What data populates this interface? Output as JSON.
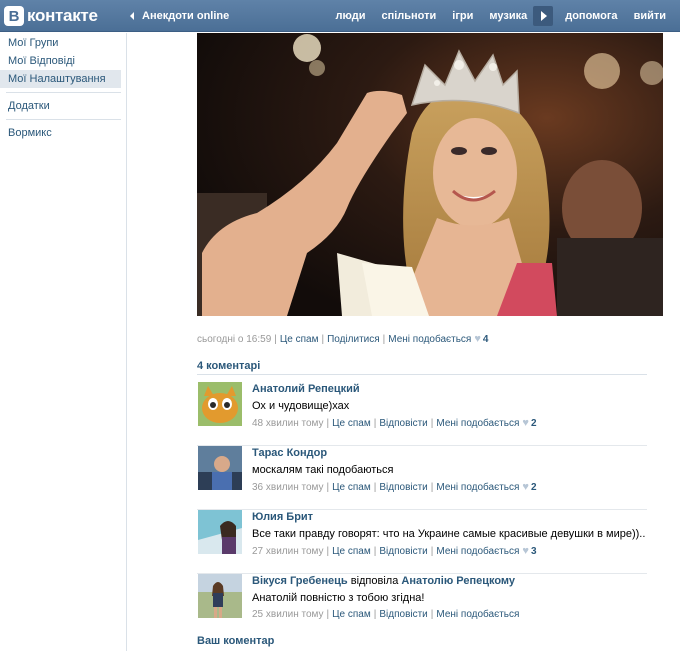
{
  "header": {
    "logo_letter": "В",
    "logo_text": "контакте",
    "back_label": "Анекдоти online",
    "nav": [
      "люди",
      "спільноти",
      "ігри",
      "музика",
      "допомога",
      "вийти"
    ]
  },
  "sidebar": {
    "items": [
      "Мої Групи",
      "Мої Відповіді",
      "Мої Налаштування",
      "Додатки",
      "Вормикс"
    ]
  },
  "post": {
    "time": "сьогодні о 16:59",
    "spam": "Це спам",
    "share": "Поділитися",
    "like": "Мені подобається",
    "like_count": "4",
    "comments_title": "4 коментарі"
  },
  "comments": [
    {
      "author": "Анатолий Репецкий",
      "text": "Ох и чудовище)хах",
      "time": "48 хвилин тому",
      "spam": "Це спам",
      "reply": "Відповісти",
      "like": "Мені подобається",
      "like_count": "2"
    },
    {
      "author": "Тарас Кондор",
      "text": "москалям такі подобаються",
      "time": "36 хвилин тому",
      "spam": "Це спам",
      "reply": "Відповісти",
      "like": "Мені подобається",
      "like_count": "2"
    },
    {
      "author": "Юлия Брит",
      "text": "Все таки правду говорят: что на Украине самые красивые девушки в мире))..",
      "time": "27 хвилин тому",
      "spam": "Це спам",
      "reply": "Відповісти",
      "like": "Мені подобається",
      "like_count": "3"
    },
    {
      "author": "Вікуся Гребенець",
      "reply_word": "відповіла",
      "reply_to": "Анатолію Репецкому",
      "text": "Анатолій повністю з тобою згідна!",
      "time": "25 хвилин тому",
      "spam": "Це спам",
      "reply": "Відповісти",
      "like": "Мені подобається"
    }
  ],
  "your_comment_label": "Ваш коментар",
  "colors": {
    "header": "#4b6f96",
    "link": "#2b587a",
    "muted": "#999999"
  }
}
